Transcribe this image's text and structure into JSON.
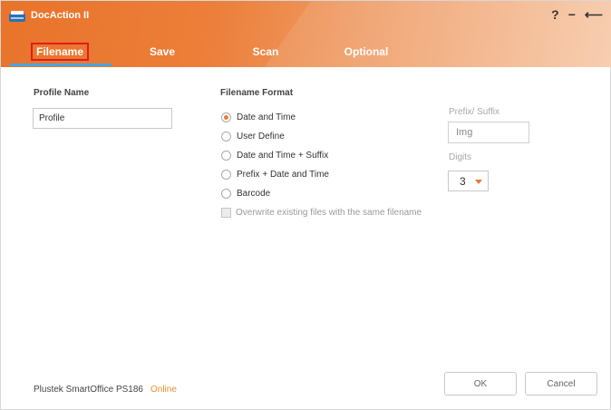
{
  "window": {
    "title": "DocAction II",
    "controls": {
      "help": "?",
      "minimize": "−",
      "back": "⟵"
    }
  },
  "tabs": [
    {
      "label": "Filename",
      "active": true
    },
    {
      "label": "Save"
    },
    {
      "label": "Scan"
    },
    {
      "label": "Optional"
    }
  ],
  "profile": {
    "label": "Profile Name",
    "value": "Profile"
  },
  "filename_format": {
    "label": "Filename Format",
    "options": [
      {
        "label": "Date and Time",
        "checked": true
      },
      {
        "label": "User Define"
      },
      {
        "label": "Date and Time + Suffix"
      },
      {
        "label": "Prefix + Date and Time"
      },
      {
        "label": "Barcode"
      }
    ],
    "overwrite_label": "Overwrite existing files with the same filename"
  },
  "prefix_suffix": {
    "label": "Prefix/ Suffix",
    "value": "Img"
  },
  "digits": {
    "label": "Digits",
    "value": "3"
  },
  "footer": {
    "device": "Plustek SmartOffice PS186",
    "status": "Online",
    "ok_label": "OK",
    "cancel_label": "Cancel"
  },
  "colors": {
    "accent": "#ee7a2e",
    "tab_underline": "#4aa6d9",
    "status_online": "#e8912f",
    "highlight_box": "#e21b1b"
  }
}
